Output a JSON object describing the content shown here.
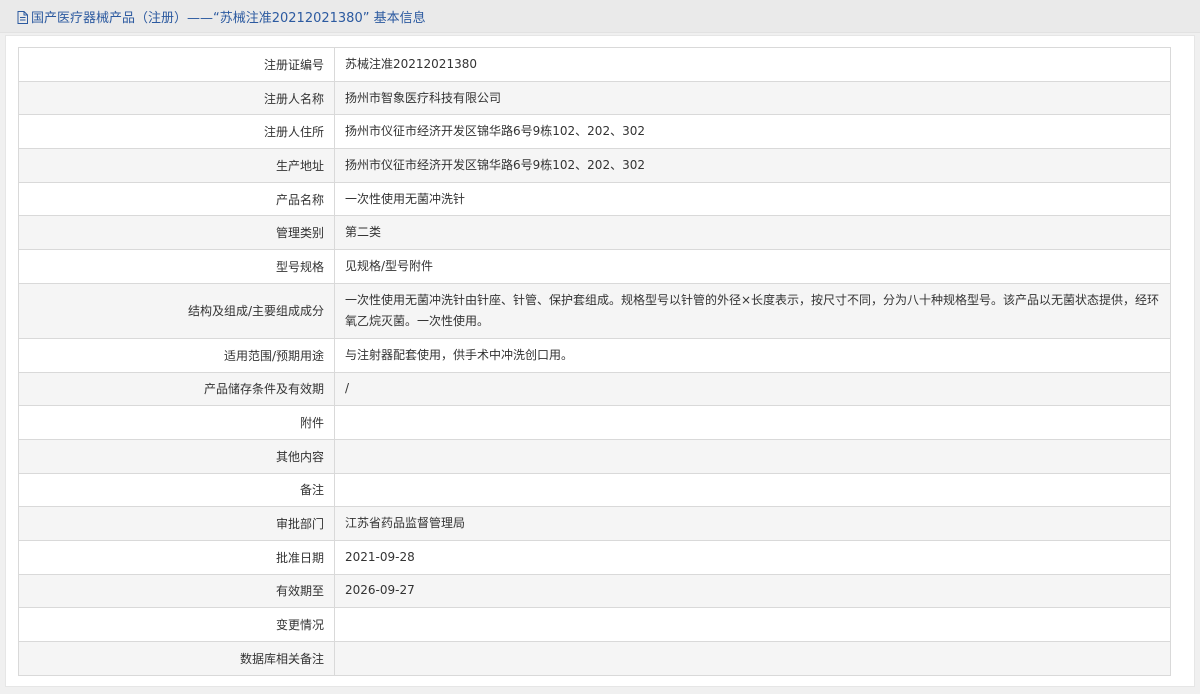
{
  "header": {
    "title": "国产医疗器械产品（注册）——“苏械注准20212021380” 基本信息"
  },
  "rows": [
    {
      "label": "注册证编号",
      "value": "苏械注准20212021380"
    },
    {
      "label": "注册人名称",
      "value": "扬州市智象医疗科技有限公司"
    },
    {
      "label": "注册人住所",
      "value": "扬州市仪征市经济开发区锦华路6号9栋102、202、302"
    },
    {
      "label": "生产地址",
      "value": "扬州市仪征市经济开发区锦华路6号9栋102、202、302"
    },
    {
      "label": "产品名称",
      "value": "一次性使用无菌冲洗针"
    },
    {
      "label": "管理类别",
      "value": "第二类"
    },
    {
      "label": "型号规格",
      "value": "见规格/型号附件"
    },
    {
      "label": "结构及组成/主要组成成分",
      "value": "一次性使用无菌冲洗针由针座、针管、保护套组成。规格型号以针管的外径×长度表示，按尺寸不同，分为八十种规格型号。该产品以无菌状态提供，经环氧乙烷灭菌。一次性使用。"
    },
    {
      "label": "适用范围/预期用途",
      "value": "与注射器配套使用，供手术中冲洗创口用。"
    },
    {
      "label": "产品储存条件及有效期",
      "value": "/"
    },
    {
      "label": "附件",
      "value": ""
    },
    {
      "label": "其他内容",
      "value": ""
    },
    {
      "label": "备注",
      "value": ""
    },
    {
      "label": "审批部门",
      "value": "江苏省药品监督管理局"
    },
    {
      "label": "批准日期",
      "value": "2021-09-28"
    },
    {
      "label": "有效期至",
      "value": "2026-09-27"
    },
    {
      "label": "变更情况",
      "value": ""
    },
    {
      "label": "数据库相关备注",
      "value": ""
    }
  ]
}
